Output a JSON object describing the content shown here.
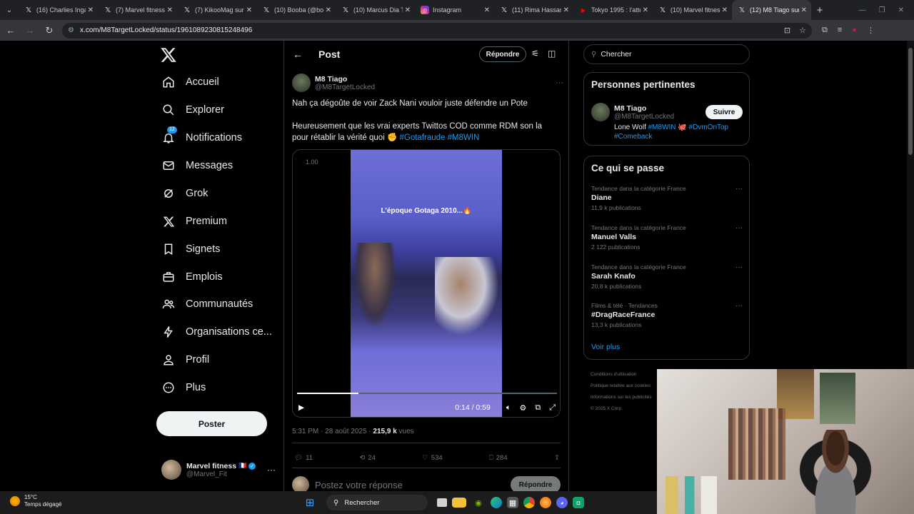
{
  "browser": {
    "tabs": [
      {
        "title": "(16) Charlies Inga",
        "icon": "x-logo-icon",
        "fav": "𝕏"
      },
      {
        "title": "(7) Marvel fitness",
        "icon": "x-logo-icon",
        "fav": "𝕏"
      },
      {
        "title": "(7) KikooMag sur",
        "icon": "x-logo-icon",
        "fav": "𝕏"
      },
      {
        "title": "(10) Booba (@bo",
        "icon": "x-logo-icon",
        "fav": "𝕏"
      },
      {
        "title": "(10) Marcus Dia T",
        "icon": "x-logo-icon",
        "fav": "𝕏"
      },
      {
        "title": "Instagram",
        "icon": "instagram-icon",
        "fav": "◎"
      },
      {
        "title": "(11) Rima Hassan",
        "icon": "x-logo-icon",
        "fav": "𝕏"
      },
      {
        "title": "Tokyo 1995 : l'atte",
        "icon": "youtube-icon",
        "fav": "▶"
      },
      {
        "title": "(10) Marvel fitnes",
        "icon": "x-logo-icon",
        "fav": "𝕏"
      },
      {
        "title": "(12) M8 Tiago sur",
        "icon": "x-logo-icon",
        "fav": "𝕏"
      }
    ],
    "url": "x.com/M8TargetLocked/status/1961089230815248496"
  },
  "nav": {
    "items": [
      {
        "label": "Accueil",
        "icon": "home-icon"
      },
      {
        "label": "Explorer",
        "icon": "search-icon"
      },
      {
        "label": "Notifications",
        "icon": "bell-icon",
        "badge": "12"
      },
      {
        "label": "Messages",
        "icon": "mail-icon"
      },
      {
        "label": "Grok",
        "icon": "grok-icon"
      },
      {
        "label": "Premium",
        "icon": "x-logo-icon"
      },
      {
        "label": "Signets",
        "icon": "bookmark-icon"
      },
      {
        "label": "Emplois",
        "icon": "briefcase-icon"
      },
      {
        "label": "Communautés",
        "icon": "people-icon"
      },
      {
        "label": "Organisations ce...",
        "icon": "lightning-icon"
      },
      {
        "label": "Profil",
        "icon": "user-icon"
      },
      {
        "label": "Plus",
        "icon": "more-circle-icon"
      }
    ],
    "post_button": "Poster",
    "account": {
      "name": "Marvel fitness",
      "flag": "🇫🇷",
      "handle": "@Marvel_Fit"
    }
  },
  "post": {
    "header_title": "Post",
    "reply_button": "Répondre",
    "author": {
      "name": "M8 Tiago",
      "handle": "@M8TargetLocked"
    },
    "text_line1": "Nah ça dégoûte de voir Zack Nani vouloir juste défendre un Pote",
    "text_line2": "Heureusement que les vrai experts Twittos COD comme RDM son la",
    "text_line3": "pour rétablir la vérité quoi ✊",
    "hashtag1": "#Gotafraude",
    "hashtag2": "#M8WIN",
    "video": {
      "speed": "1.00",
      "caption": "L’époque Gotaga 2010...🔥",
      "time": "0:14 / 0:59",
      "progress": 0.237
    },
    "meta_time": "5:31 PM · 28 août 2025 · ",
    "meta_views": "215,9 k",
    "meta_views_label": " vues",
    "stats": {
      "replies": "11",
      "reposts": "24",
      "likes": "534",
      "bookmarks": "284"
    },
    "reply_placeholder": "Postez votre réponse",
    "reply_submit": "Répondre"
  },
  "right": {
    "search_placeholder": "Chercher",
    "relevant": {
      "title": "Personnes pertinentes",
      "name": "M8 Tiago",
      "handle": "@M8TargetLocked",
      "follow": "Suivre",
      "bio_text": "Lone Wolf ",
      "bio_tag1": "#M8WIN",
      "bio_tag2": "#DvmOnTop",
      "bio_tag3": "#Comeback"
    },
    "trends": {
      "title": "Ce qui se passe",
      "items": [
        {
          "cat": "Tendance dans la catégorie France",
          "name": "Diane",
          "count": "11,9 k publications"
        },
        {
          "cat": "Tendance dans la catégorie France",
          "name": "Manuel Valls",
          "count": "2 122 publications"
        },
        {
          "cat": "Tendance dans la catégorie France",
          "name": "Sarah Knafo",
          "count": "20,8 k publications"
        },
        {
          "cat": "Films & télé · Tendances",
          "name": "#DragRaceFrance",
          "count": "13,3 k publications"
        }
      ],
      "see_more": "Voir plus"
    },
    "footer": [
      "Conditions d'utilisation",
      "Politique relative aux cookies",
      "Informations sur les publicités",
      "© 2025 X Corp."
    ]
  },
  "taskbar": {
    "temp": "15°C",
    "weather": "Temps dégagé",
    "search": "Rechercher"
  },
  "colors": {
    "accent": "#1d9bf0",
    "bg": "#000000",
    "border": "#2f3336",
    "muted": "#71767b"
  }
}
